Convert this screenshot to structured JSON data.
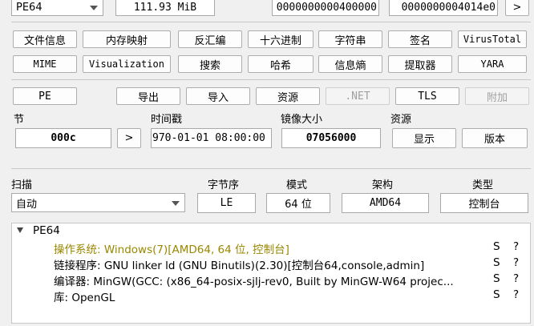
{
  "top": {
    "type_select": "PE64",
    "size": "111.93 MiB",
    "addr1": "0000000000400000",
    "addr2": "0000000004014e0",
    "next": ">"
  },
  "tools_row1": [
    "文件信息",
    "内存映射",
    "反汇编",
    "十六进制",
    "字符串",
    "签名",
    "VirusTotal"
  ],
  "tools_row2": [
    "MIME",
    "Visualization",
    "搜索",
    "哈希",
    "信息熵",
    "提取器",
    "YARA"
  ],
  "pe_tabs": [
    "PE",
    "导出",
    "导入",
    "资源",
    ".NET",
    "TLS",
    "附加"
  ],
  "info": {
    "section_label": "节",
    "section_value": "000c",
    "section_btn": ">",
    "time_label": "时间戳",
    "time_value": "970-01-01 08:00:00",
    "image_label": "镜像大小",
    "image_value": "07056000",
    "resource_label": "资源",
    "show_btn": "显示",
    "version_btn": "版本"
  },
  "scan": {
    "scan_label": "扫描",
    "scan_value": "自动",
    "endian_label": "字节序",
    "endian_value": "LE",
    "mode_label": "模式",
    "mode_value": "64 位",
    "arch_label": "架构",
    "arch_value": "AMD64",
    "type_label": "类型",
    "type_value": "控制台"
  },
  "tree": {
    "root": "PE64",
    "items": [
      {
        "text": "操作系统: Windows(7)[AMD64, 64 位, 控制台]",
        "s": "S",
        "q": "?",
        "highlight": true
      },
      {
        "text": "链接程序: GNU linker ld (GNU Binutils)(2.30)[控制台64,console,admin]",
        "s": "S",
        "q": "?",
        "highlight": false
      },
      {
        "text": "编译器: MinGW(GCC: (x86_64-posix-sjlj-rev0, Built by MinGW-W64 projec...",
        "s": "S",
        "q": "?",
        "highlight": false
      },
      {
        "text": "库: OpenGL",
        "s": "S",
        "q": "?",
        "highlight": false
      }
    ]
  },
  "colors": {
    "highlight": "#9a8700"
  }
}
